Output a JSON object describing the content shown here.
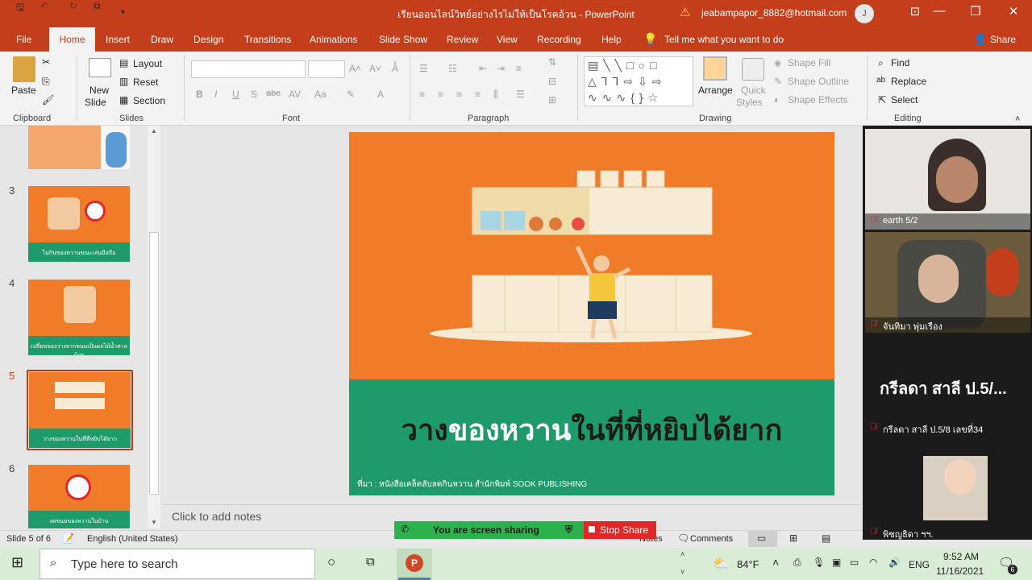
{
  "titlebar": {
    "doc_title": "เรียนออนไลน์วิทย์อย่างไรไม่ให้เป็นโรคอ้วน  -  PowerPoint",
    "user_email": "jeabampapor_8882@hotmail.com",
    "avatar_initial": "J"
  },
  "menu": {
    "tabs": [
      "File",
      "Home",
      "Insert",
      "Draw",
      "Design",
      "Transitions",
      "Animations",
      "Slide Show",
      "Review",
      "View",
      "Recording",
      "Help"
    ],
    "tell_me": "Tell me what you want to do",
    "share": "Share"
  },
  "ribbon": {
    "clipboard": {
      "paste": "Paste",
      "label": "Clipboard"
    },
    "slides": {
      "new_slide_1": "New",
      "new_slide_2": "Slide",
      "layout": "Layout",
      "reset": "Reset",
      "section": "Section",
      "label": "Slides"
    },
    "font": {
      "label": "Font"
    },
    "paragraph": {
      "label": "Paragraph"
    },
    "drawing": {
      "arrange": "Arrange",
      "quick_styles_1": "Quick",
      "quick_styles_2": "Styles",
      "shape_fill": "Shape Fill",
      "shape_outline": "Shape Outline",
      "shape_effects": "Shape Effects",
      "label": "Drawing"
    },
    "editing": {
      "find": "Find",
      "replace": "Replace",
      "select": "Select",
      "label": "Editing"
    }
  },
  "thumbnails": [
    {
      "num": "3",
      "caption": "ไม่กินของหวานขณะเล่นมือถือ"
    },
    {
      "num": "4",
      "caption": "เปลี่ยนของว่างจากขนมเป็นผลไม้น้ำตาลน้อย"
    },
    {
      "num": "5",
      "caption": "วางของหวานในที่ที่หยิบได้ยาก"
    },
    {
      "num": "6",
      "caption": "งดขนมของหวานในบ้าน"
    }
  ],
  "slide": {
    "title_part1": "วาง",
    "title_part2": "ของหวาน",
    "title_part3": "ในที่ที่หยิบได้ยาก",
    "source": "ที่มา : หนังสือเคล็ดลับลดกินหวาน สำนักพิมพ์ SOOK PUBLISHING"
  },
  "notes_placeholder": "Click to add notes",
  "status": {
    "slide_counter": "Slide 5 of 6",
    "language": "English (United States)",
    "notes": "Notes",
    "comments": "Comments"
  },
  "screen_share": {
    "sharing_text": "You are screen sharing",
    "stop_label": "Stop Share"
  },
  "video": {
    "p1": "earth 5/2",
    "p2": "จันทิมา พุ่มเรือง",
    "p3_big": "กรีลดา สาลี ป.5/...",
    "p3": "กรีลดา สาลี ป.5/8 เลขที่34",
    "p4": "พิชญธิดา ฯฯ."
  },
  "taskbar": {
    "search_placeholder": "Type here to search",
    "temperature": "84°F",
    "language": "ENG",
    "time": "9:52 AM",
    "date": "11/16/2021",
    "notif_count": "6"
  },
  "colors": {
    "accent": "#c43e1c",
    "slide_orange": "#f07c2a",
    "slide_green": "#1e9a6b",
    "share_green": "#2bb24c",
    "stop_red": "#e02828"
  }
}
